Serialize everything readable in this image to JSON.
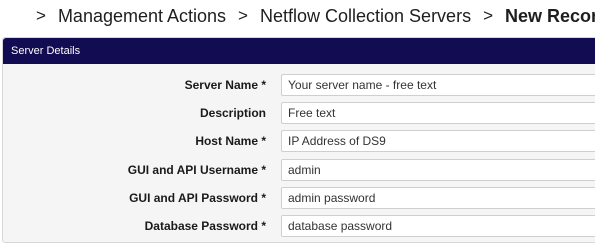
{
  "breadcrumb": {
    "items": [
      "Management Actions",
      "Netflow Collection Servers"
    ],
    "current": "New Record",
    "separator": ">"
  },
  "panel": {
    "title": "Server Details"
  },
  "form": {
    "fields": [
      {
        "label": "Server Name *",
        "placeholder": "Your server name - free text"
      },
      {
        "label": "Description",
        "placeholder": "Free text"
      },
      {
        "label": "Host Name *",
        "placeholder": "IP Address of DS9"
      },
      {
        "label": "GUI and API Username *",
        "placeholder": "admin"
      },
      {
        "label": "GUI and API Password *",
        "placeholder": "admin password"
      },
      {
        "label": "Database Password *",
        "placeholder": "database password"
      }
    ]
  },
  "colors": {
    "header_bg": "#120c52",
    "panel_bg": "#f5f5f5"
  },
  "icons": {
    "home": "home-icon"
  }
}
